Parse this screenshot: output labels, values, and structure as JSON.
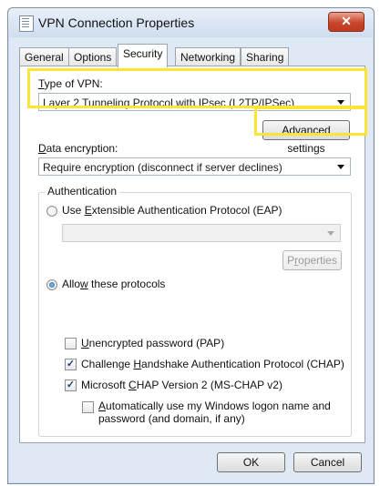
{
  "window": {
    "title": "VPN Connection Properties",
    "close_glyph": "✕"
  },
  "tabs": [
    {
      "label": "General"
    },
    {
      "label": "Options"
    },
    {
      "label": "Security"
    },
    {
      "label": "Networking"
    },
    {
      "label": "Sharing"
    }
  ],
  "vpn_type": {
    "label_prefix": "T",
    "label_rest": "ype of VPN:",
    "selected": "Layer 2 Tunneling Protocol with IPsec (L2TP/IPSec)"
  },
  "advanced_settings_label": "Advanced settings",
  "encryption": {
    "label_prefix": "D",
    "label_rest": "ata encryption:",
    "selected": "Require encryption (disconnect if server declines)"
  },
  "authentication": {
    "group_title": "Authentication",
    "eap_radio": {
      "pre": "Use ",
      "key": "E",
      "post": "xtensible Authentication Protocol (EAP)",
      "checked": false
    },
    "eap_dropdown_value": "",
    "properties_button": {
      "pre": "P",
      "key": "r",
      "post": "operties"
    },
    "allow_radio": {
      "pre": "Allo",
      "key": "w",
      "post": " these protocols",
      "checked": true
    },
    "pap": {
      "pre": "",
      "key": "U",
      "post": "nencrypted password (PAP)",
      "checked": false
    },
    "chap": {
      "pre": "Challenge ",
      "key": "H",
      "post": "andshake Authentication Protocol (CHAP)",
      "checked": true
    },
    "mschap": {
      "pre": "Microsoft ",
      "key": "C",
      "post": "HAP Version 2 (MS-CHAP v2)",
      "checked": true
    },
    "auto_logon": {
      "pre": "",
      "key": "A",
      "post": "utomatically use my Windows logon name and",
      "line2": "password (and domain, if any)",
      "checked": false
    }
  },
  "footer": {
    "ok": "OK",
    "cancel": "Cancel"
  },
  "colors": {
    "highlight": "#ffe533"
  }
}
